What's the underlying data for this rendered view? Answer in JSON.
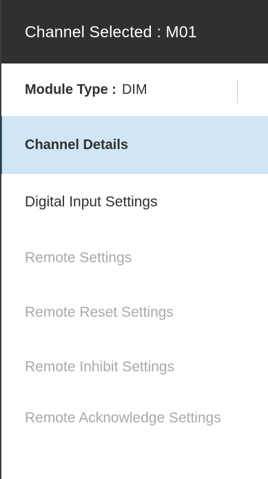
{
  "header": {
    "title": "Channel Selected : M01"
  },
  "module": {
    "label": "Module Type :",
    "value": "DIM"
  },
  "nav": {
    "items": [
      {
        "label": "Channel Details",
        "state": "active"
      },
      {
        "label": "Digital Input Settings",
        "state": "enabled"
      },
      {
        "label": "Remote Settings",
        "state": "disabled"
      },
      {
        "label": "Remote Reset Settings",
        "state": "disabled"
      },
      {
        "label": "Remote Inhibit Settings",
        "state": "disabled"
      },
      {
        "label": "Remote Acknowledge Settings",
        "state": "disabled"
      }
    ]
  },
  "colors": {
    "header_bg": "#303030",
    "active_bg": "#d1e6f5",
    "active_accent": "#1f78b4",
    "disabled_text": "#a9a9a9"
  }
}
